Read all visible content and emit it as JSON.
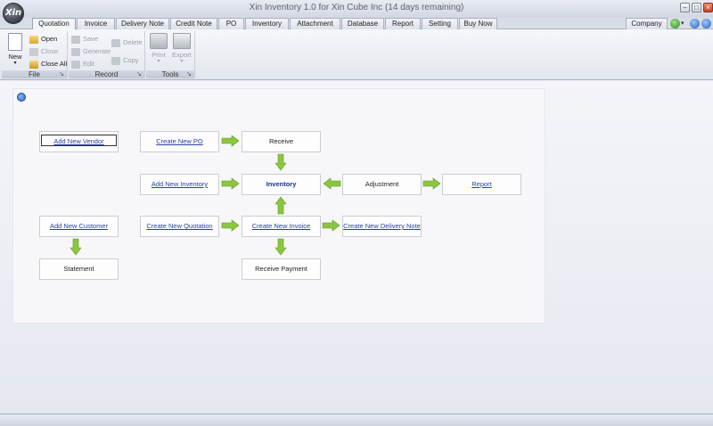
{
  "window": {
    "title": "Xin Inventory 1.0 for Xin Cube Inc (14 days remaining)",
    "logo_text": "Xin"
  },
  "tabs": [
    "Quotation",
    "Invoice",
    "Delivery Note",
    "Credit Note",
    "PO",
    "Inventory",
    "Attachment",
    "Database",
    "Report",
    "Setting",
    "Buy Now"
  ],
  "active_tab": "Quotation",
  "company_tab": "Company",
  "ribbon": {
    "file": {
      "label": "File",
      "new": "New",
      "open": "Open",
      "close": "Close",
      "close_all": "Close All"
    },
    "record": {
      "label": "Record",
      "save": "Save",
      "generate": "Generate",
      "edit": "Edit",
      "delete": "Delete",
      "copy": "Copy"
    },
    "tools": {
      "label": "Tools",
      "print": "Print",
      "export": "Export"
    }
  },
  "workflow": {
    "add_new_vendor": "Add New Vendor",
    "create_new_po": "Create New PO",
    "receive": "Receive",
    "add_new_inventory": "Add New Inventory",
    "inventory": "Inventory",
    "adjustment": "Adjustment",
    "report": "Report",
    "add_new_customer": "Add New Customer",
    "create_new_quotation": "Create New Quotation",
    "create_new_invoice": "Create New Invoice",
    "create_new_delivery_note": "Create New Delivery Note",
    "statement": "Statement",
    "receive_payment": "Receive Payment"
  },
  "colors": {
    "arrow": "#8cc63f",
    "link": "#2a3fa8"
  }
}
